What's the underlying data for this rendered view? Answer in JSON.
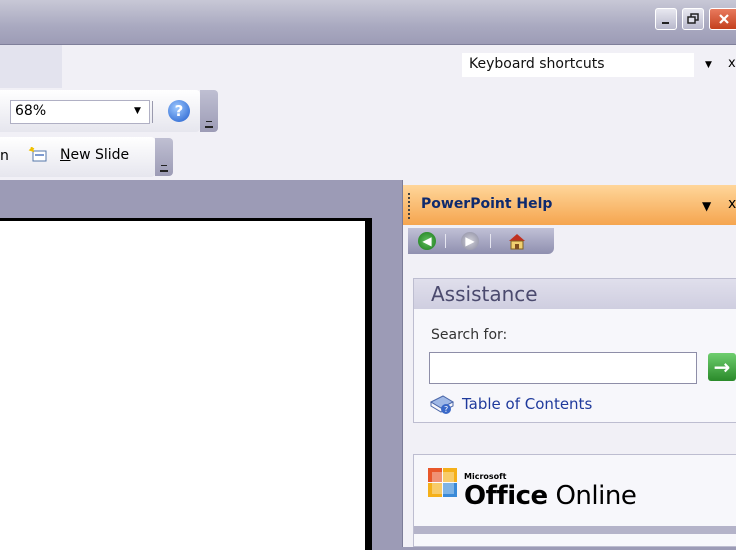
{
  "menubar": {
    "help_box_value": "Keyboard shortcuts",
    "close_glyph": "x"
  },
  "toolbar": {
    "zoom_value": "68%",
    "help_icon_glyph": "?",
    "tb2_fragment": "n",
    "new_slide_label_rest": "ew Slide",
    "new_slide_accel": "N"
  },
  "pane": {
    "title": "PowerPoint Help",
    "close_glyph": "x",
    "assistance_title": "Assistance",
    "search_label": "Search for:",
    "search_value": "",
    "toc_label": "Table of Contents",
    "office_ms": "Microsoft",
    "office_brand_bold": "Office",
    "office_brand_rest": " Online"
  },
  "colors": {
    "pane_title_start": "#ffd69a",
    "pane_title_end": "#f5a54f",
    "workspace": "#9c9bb6",
    "link": "#1f3a9c"
  },
  "icons": [
    "minimize-icon",
    "restore-icon",
    "close-icon",
    "help-icon",
    "new-slide-icon",
    "back-icon",
    "forward-icon",
    "home-icon",
    "go-arrow-icon",
    "table-of-contents-icon",
    "office-logo-icon"
  ]
}
